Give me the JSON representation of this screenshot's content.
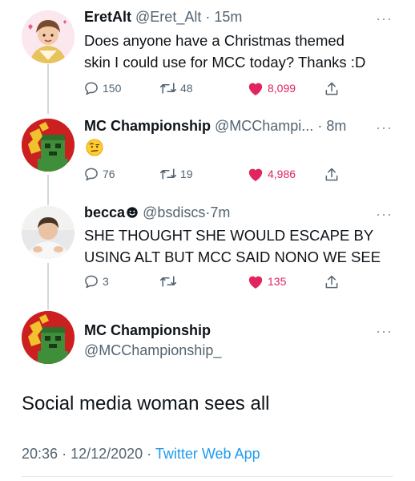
{
  "tweets": [
    {
      "name": "EretAlt",
      "handle": "@Eret_Alt",
      "dot": "·",
      "time": "15m",
      "text_lines": [
        "Does anyone have a Christmas themed",
        "skin I could use for MCC today? Thanks :D"
      ],
      "replies": "150",
      "retweets": "48",
      "likes": "8,099"
    },
    {
      "name": "MC Championship",
      "handle": "@MCChampi...",
      "dot": "·",
      "time": "8m",
      "emoji": "raised-eyebrow-face",
      "replies": "76",
      "retweets": "19",
      "likes": "4,986"
    },
    {
      "name": "becca",
      "handle": "@bsdiscs",
      "dot": "·",
      "time": "7m",
      "text_lines": [
        "SHE THOUGHT SHE WOULD ESCAPE BY",
        "USING ALT BUT MCC SAID NONO WE SEE"
      ],
      "replies": "3",
      "retweets": "",
      "likes": "135"
    }
  ],
  "main_tweet": {
    "name": "MC Championship",
    "handle": "@MCChampionship_",
    "text": "Social media woman sees all",
    "time": "20:36",
    "date": "12/12/2020",
    "source": "Twitter Web App",
    "dot": "·"
  },
  "ui": {
    "more": "···"
  },
  "colors": {
    "like": "#e0245e",
    "link": "#1d9bf0",
    "muted": "#536471",
    "thread_line": "#cfd9de"
  }
}
